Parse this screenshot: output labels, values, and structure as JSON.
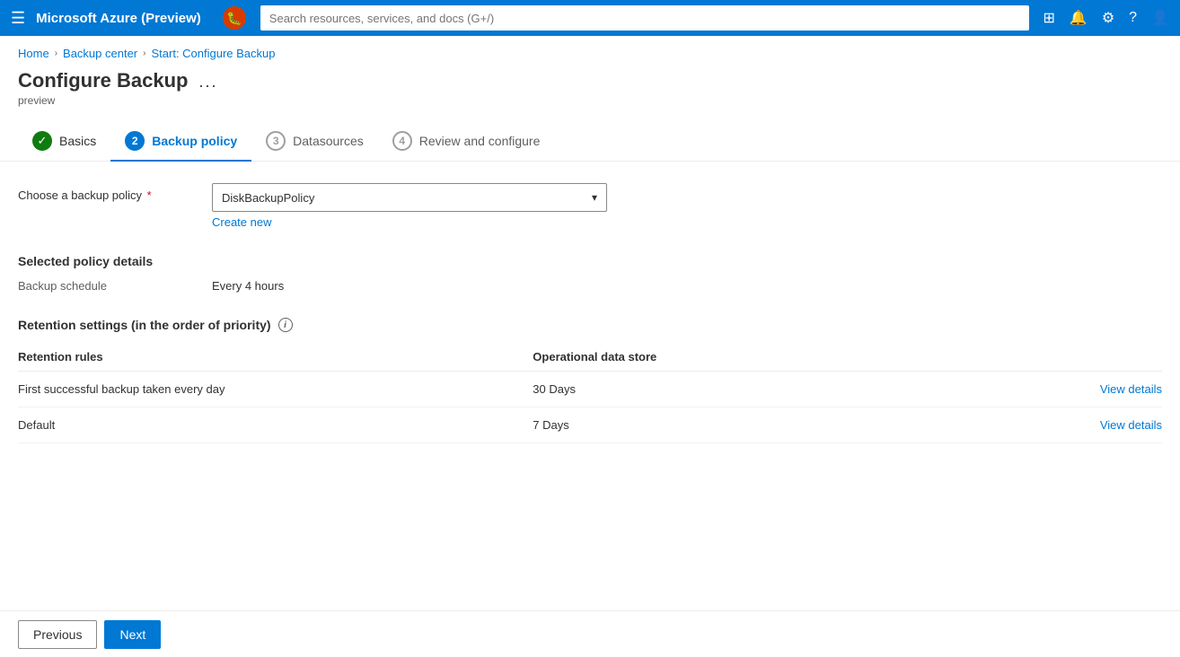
{
  "topbar": {
    "title": "Microsoft Azure (Preview)",
    "search_placeholder": "Search resources, services, and docs (G+/)",
    "bug_icon": "🐛"
  },
  "breadcrumb": {
    "items": [
      "Home",
      "Backup center",
      "Start: Configure Backup"
    ]
  },
  "page": {
    "title": "Configure Backup",
    "subtitle": "preview",
    "more_label": "..."
  },
  "tabs": [
    {
      "id": "basics",
      "number": "1",
      "label": "Basics",
      "state": "completed"
    },
    {
      "id": "backup-policy",
      "number": "2",
      "label": "Backup policy",
      "state": "active"
    },
    {
      "id": "datasources",
      "number": "3",
      "label": "Datasources",
      "state": "inactive"
    },
    {
      "id": "review",
      "number": "4",
      "label": "Review and configure",
      "state": "inactive"
    }
  ],
  "form": {
    "policy_label": "Choose a backup policy",
    "policy_value": "DiskBackupPolicy",
    "create_new_label": "Create new"
  },
  "policy_details": {
    "section_title": "Selected policy details",
    "schedule_label": "Backup schedule",
    "schedule_value": "Every 4 hours"
  },
  "retention": {
    "section_title": "Retention settings (in the order of priority)",
    "columns": {
      "rules": "Retention rules",
      "store": "Operational data store"
    },
    "rows": [
      {
        "rule": "First successful backup taken every day",
        "store": "30 Days",
        "action": "View details"
      },
      {
        "rule": "Default",
        "store": "7 Days",
        "action": "View details"
      }
    ]
  },
  "footer": {
    "previous_label": "Previous",
    "next_label": "Next"
  }
}
